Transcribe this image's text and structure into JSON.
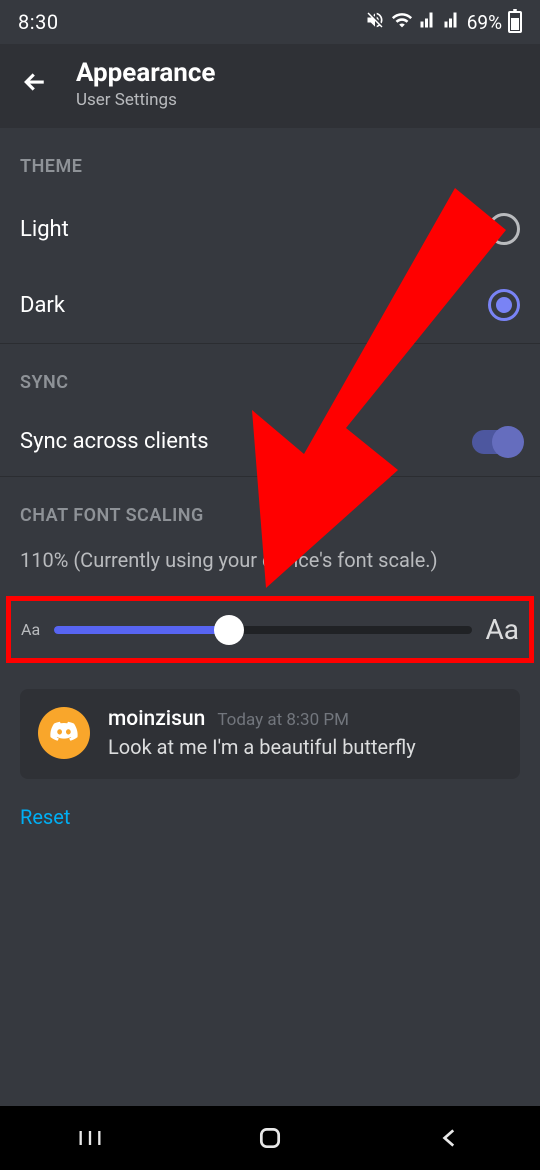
{
  "status": {
    "time": "8:30",
    "battery_pct": "69%"
  },
  "header": {
    "title": "Appearance",
    "subtitle": "User Settings"
  },
  "sections": {
    "theme": {
      "label": "THEME",
      "options": {
        "light": "Light",
        "dark": "Dark"
      },
      "selected": "dark"
    },
    "sync": {
      "label": "SYNC",
      "row_label": "Sync across clients",
      "enabled": true
    },
    "scaling": {
      "label": "CHAT FONT SCALING",
      "description": "110% (Currently using your device's font scale.)",
      "small_aa": "Aa",
      "large_aa": "Aa",
      "slider_pct": 42
    }
  },
  "preview": {
    "username": "moinzisun",
    "timestamp": "Today at 8:30 PM",
    "message": "Look at me I'm a beautiful butterfly"
  },
  "reset_label": "Reset",
  "colors": {
    "accent": "#5865f2",
    "radio_selected": "#7983f5",
    "highlight": "#ff0000",
    "avatar_bg": "#f9a62b",
    "link": "#00aff4"
  }
}
